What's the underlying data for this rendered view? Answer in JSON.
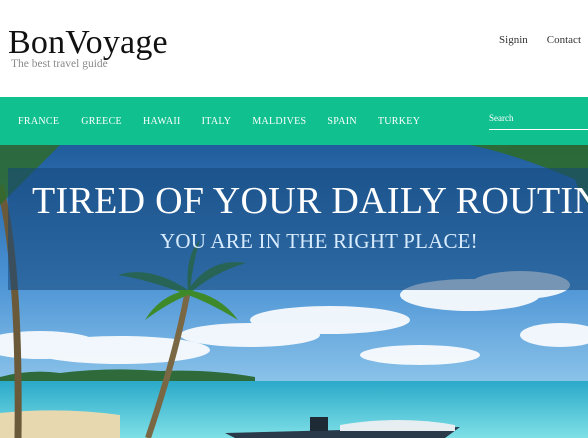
{
  "header": {
    "logo": "BonVoyage",
    "tagline": "The best travel guide",
    "links": [
      "Signin",
      "Contact"
    ]
  },
  "nav": {
    "items": [
      "FRANCE",
      "GREECE",
      "HAWAII",
      "ITALY",
      "MALDIVES",
      "SPAIN",
      "TURKEY"
    ],
    "search_placeholder": "Search"
  },
  "hero": {
    "headline": "TIRED OF YOUR DAILY ROUTINE?",
    "subline": "YOU ARE IN THE RIGHT PLACE!"
  },
  "colors": {
    "nav": "#10c08e",
    "banner": "rgba(20,70,120,0.55)",
    "sky": "#3a7fc4",
    "sea": "#3ec8d8"
  }
}
